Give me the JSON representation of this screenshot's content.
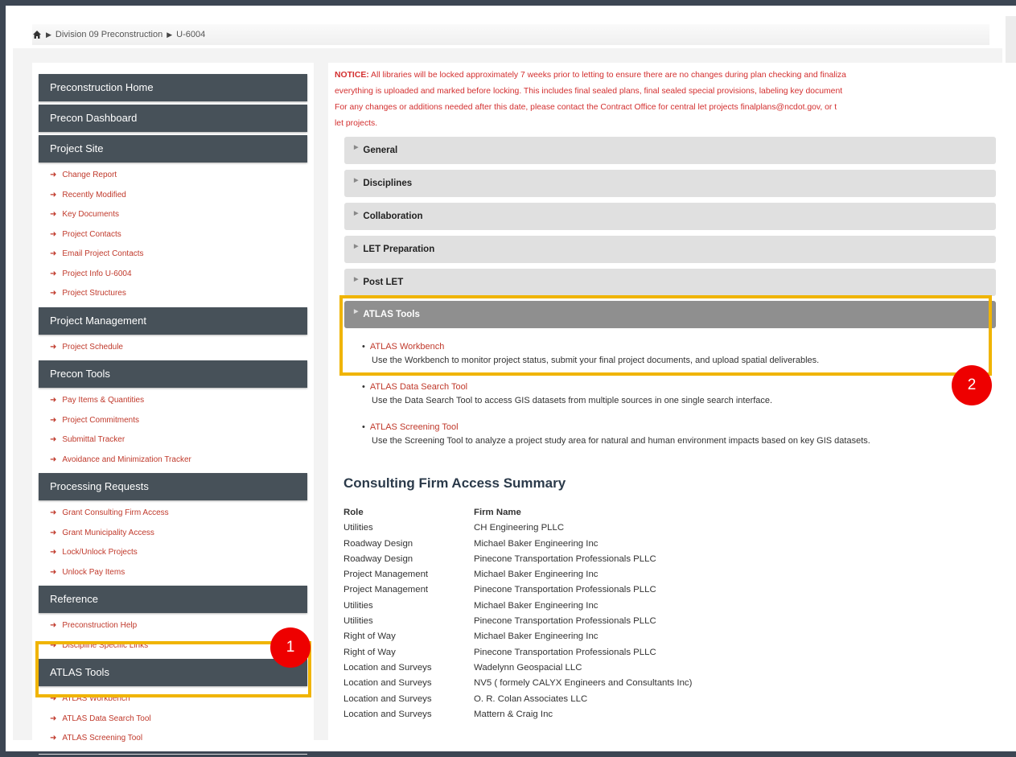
{
  "breadcrumb": {
    "items": [
      "Division 09 Preconstruction",
      "U-6004"
    ]
  },
  "sidebar": {
    "top_headers": [
      "Preconstruction Home",
      "Precon Dashboard"
    ],
    "groups": [
      {
        "title": "Project Site",
        "links": [
          "Change Report",
          "Recently Modified",
          "Key Documents",
          "Project Contacts",
          "Email Project Contacts",
          "Project Info U-6004",
          "Project Structures"
        ]
      },
      {
        "title": "Project Management",
        "links": [
          "Project Schedule"
        ]
      },
      {
        "title": "Precon Tools",
        "links": [
          "Pay Items & Quantities",
          "Project Commitments",
          "Submittal Tracker",
          "Avoidance and Minimization Tracker"
        ]
      },
      {
        "title": "Processing Requests",
        "links": [
          "Grant Consulting Firm Access",
          "Grant Municipality Access",
          "Lock/Unlock Projects",
          "Unlock Pay Items"
        ]
      },
      {
        "title": "Reference",
        "links": [
          "Preconstruction Help",
          "Discipline Specific Links"
        ]
      },
      {
        "title": "ATLAS Tools",
        "links": [
          "ATLAS Workbench",
          "ATLAS Data Search Tool",
          "ATLAS Screening Tool"
        ]
      }
    ]
  },
  "notice": {
    "label": "NOTICE:",
    "lines": [
      " All libraries will be locked approximately 7 weeks prior to letting to ensure there are no changes during plan checking and finaliza",
      "everything is uploaded and marked before locking.  This includes final sealed plans, final sealed special provisions, labeling key document",
      "For any changes or additions needed after this date, please contact the Contract Office for central let projects finalplans@ncdot.gov, or t",
      "let projects."
    ]
  },
  "accordions": [
    "General",
    "Disciplines",
    "Collaboration",
    "LET Preparation",
    "Post LET",
    "ATLAS Tools"
  ],
  "atlas_tools": [
    {
      "title": "ATLAS Workbench",
      "desc": "Use the Workbench to monitor project status, submit your final project documents, and upload spatial deliverables."
    },
    {
      "title": "ATLAS Data Search Tool",
      "desc": "Use the Data Search Tool to access GIS datasets from multiple sources in one single search interface."
    },
    {
      "title": "ATLAS Screening Tool",
      "desc": "Use the Screening Tool to analyze a project study area for natural and human environment impacts based on key GIS datasets."
    }
  ],
  "consulting": {
    "title": "Consulting Firm Access Summary",
    "headers": [
      "Role",
      "Firm Name"
    ],
    "rows": [
      [
        "Utilities",
        "CH Engineering PLLC"
      ],
      [
        "Roadway Design",
        "Michael Baker Engineering Inc"
      ],
      [
        "Roadway Design",
        "Pinecone Transportation Professionals PLLC"
      ],
      [
        "Project Management",
        "Michael Baker Engineering Inc"
      ],
      [
        "Project Management",
        "Pinecone Transportation Professionals PLLC"
      ],
      [
        "Utilities",
        "Michael Baker Engineering Inc"
      ],
      [
        "Utilities",
        "Pinecone Transportation Professionals PLLC"
      ],
      [
        "Right of Way",
        "Michael Baker Engineering Inc"
      ],
      [
        "Right of Way",
        "Pinecone Transportation Professionals PLLC"
      ],
      [
        "Location and Surveys",
        "Wadelynn Geospacial LLC"
      ],
      [
        "Location and Surveys",
        "NV5 ( formely CALYX Engineers and Consultants Inc)"
      ],
      [
        "Location and Surveys",
        "O. R. Colan Associates LLC"
      ],
      [
        "Location and Surveys",
        "Mattern & Craig Inc"
      ]
    ]
  },
  "callouts": [
    "1",
    "2"
  ],
  "colors": {
    "nav_header": "#475159",
    "link_red": "#c0392b",
    "highlight": "#f0b400",
    "callout_red": "#ee0000"
  },
  "icons": {
    "home": "home-icon",
    "breadcrumb_separator": "triangle-right-icon",
    "link_arrow": "arrow-right-icon"
  }
}
